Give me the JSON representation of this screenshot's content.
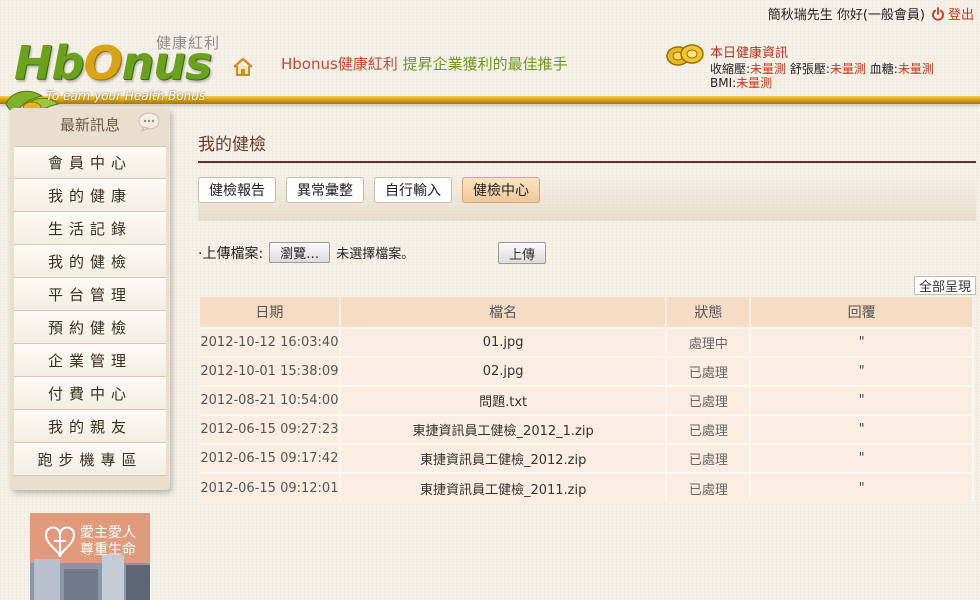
{
  "header": {
    "logo_sub": "健康紅利",
    "logo_word_1": "Hb",
    "logo_word_o": "O",
    "logo_word_2": "nus",
    "logo_tag": "To earn your Health Bonus",
    "slogan_brand": "Hbonus健康紅利",
    "slogan_rest": " 提昇企業獲利的最佳推手",
    "user_greeting": "簡秋瑞先生 你好(一般會員)",
    "logout_label": "登出"
  },
  "health_info": {
    "title": "本日健康資訊",
    "systolic_label": "收縮壓:",
    "systolic_value": "未量測",
    "diastolic_label": "舒張壓:",
    "diastolic_value": "未量測",
    "sugar_label": "血糖:",
    "sugar_value": "未量測",
    "bmi_label": "BMI:",
    "bmi_value": "未量測"
  },
  "sidebar": {
    "news_title": "最新訊息",
    "items": [
      {
        "label": "會員中心"
      },
      {
        "label": "我的健康"
      },
      {
        "label": "生活記錄"
      },
      {
        "label": "我的健檢"
      },
      {
        "label": "平台管理"
      },
      {
        "label": "預約健檢"
      },
      {
        "label": "企業管理"
      },
      {
        "label": "付費中心"
      },
      {
        "label": "我的親友"
      },
      {
        "label": "跑步機專區"
      }
    ],
    "promo_line1": "愛主愛人",
    "promo_line2": "尊重生命"
  },
  "main": {
    "title": "我的健檢",
    "tabs": [
      {
        "label": "健檢報告",
        "active": false
      },
      {
        "label": "異常彙整",
        "active": false
      },
      {
        "label": "自行輸入",
        "active": false
      },
      {
        "label": "健檢中心",
        "active": true
      }
    ],
    "upload_label": "·上傳檔案:",
    "browse_label": "瀏覽…",
    "no_file_text": "未選擇檔案。",
    "upload_button": "上傳",
    "show_all": "全部呈現",
    "table": {
      "headers": [
        "日期",
        "檔名",
        "狀態",
        "回覆"
      ],
      "rows": [
        [
          "2012-10-12 16:03:40",
          "01.jpg",
          "處理中",
          "\""
        ],
        [
          "2012-10-01 15:38:09",
          "02.jpg",
          "已處理",
          "\""
        ],
        [
          "2012-08-21 10:54:00",
          "問題.txt",
          "已處理",
          "\""
        ],
        [
          "2012-06-15 09:27:23",
          "東捷資訊員工健檢_2012_1.zip",
          "已處理",
          "\""
        ],
        [
          "2012-06-15 09:17:42",
          "東捷資訊員工健檢_2012.zip",
          "已處理",
          "\""
        ],
        [
          "2012-06-15 09:12:01",
          "東捷資訊員工健檢_2011.zip",
          "已處理",
          "\""
        ]
      ]
    }
  },
  "colors": {
    "accent_gold": "#d49d10",
    "brand_green": "#6aa21e",
    "alert_red": "#c53a1e",
    "tab_active": "#f0c898"
  }
}
